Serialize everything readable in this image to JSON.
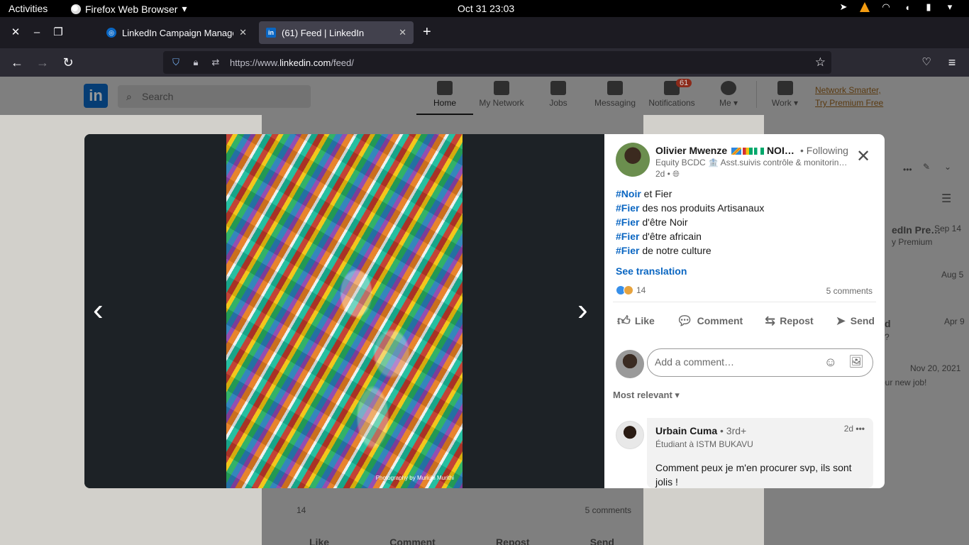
{
  "system_bar": {
    "activities": "Activities",
    "app_name": "Firefox Web Browser",
    "clock": "Oct 31  23:03"
  },
  "browser": {
    "tabs": [
      {
        "title": "LinkedIn Campaign Manager",
        "active": false
      },
      {
        "title": "(61) Feed | LinkedIn",
        "active": true
      }
    ],
    "url_prefix": "https://www.",
    "url_domain": "linkedin.com",
    "url_path": "/feed/"
  },
  "linkedin_header": {
    "search_placeholder": "Search",
    "nav": [
      {
        "label": "Home",
        "active": true
      },
      {
        "label": "My Network"
      },
      {
        "label": "Jobs"
      },
      {
        "label": "Messaging"
      },
      {
        "label": "Notifications",
        "badge": "61"
      },
      {
        "label": "Me ▾"
      }
    ],
    "work_label": "Work ▾",
    "premium_line1": "Network Smarter,",
    "premium_line2": "Try Premium Free"
  },
  "background_feed": {
    "reactions": "14",
    "comments": "5 comments",
    "actions": [
      "Like",
      "Comment",
      "Repost",
      "Send"
    ]
  },
  "background_sidebar": {
    "items": [
      {
        "text": "edIn Pre…",
        "sub": "y Premium",
        "date": "Sep 14"
      },
      {
        "text": "",
        "sub": "",
        "date": "Aug 5"
      },
      {
        "text": "d",
        "sub": "?",
        "date": "Apr 9"
      },
      {
        "text": "",
        "sub": "our new job!",
        "date": "Nov 20, 2021"
      }
    ]
  },
  "modal": {
    "photo_credit": "Photography by Muriuki Murithi",
    "post": {
      "author": "Olivier Mwenze",
      "author_suffix": "NOI…",
      "following": "• Following",
      "headline": "Equity BCDC 🏦 Asst.suivis contrôle & monitorin…",
      "age": "2d •",
      "lines": [
        {
          "tag": "#Noir",
          "text": " et Fier"
        },
        {
          "tag": "#Fier",
          "text": " des nos produits Artisanaux"
        },
        {
          "tag": "#Fier",
          "text": " d'être Noir"
        },
        {
          "tag": "#Fier",
          "text": " d'être africain"
        },
        {
          "tag": "#Fier",
          "text": " de notre culture"
        }
      ],
      "see_translation": "See translation",
      "reaction_count": "14",
      "comment_count": "5 comments",
      "actions": {
        "like": "Like",
        "comment": "Comment",
        "repost": "Repost",
        "send": "Send"
      },
      "comment_placeholder": "Add a comment…",
      "sort": "Most relevant ▾"
    },
    "comment": {
      "name": "Urbain Cuma",
      "degree": " • 3rd+",
      "headline": "Étudiant à ISTM BUKAVU",
      "age": "2d",
      "text": "Comment peux je m'en procurer svp, ils sont jolis !"
    }
  },
  "colors": {
    "linkedin_blue": "#0a66c2",
    "firefox_tabbar": "#1c1b22",
    "firefox_navbar": "#2b2a33"
  }
}
